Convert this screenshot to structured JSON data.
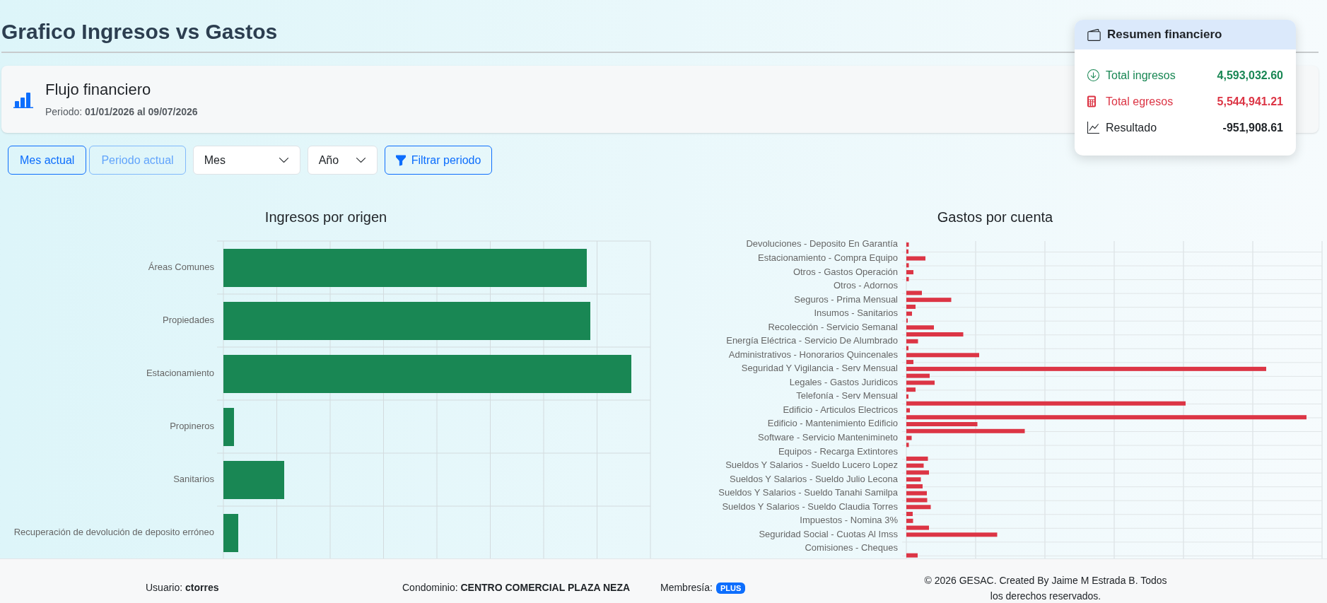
{
  "page": {
    "title": "Grafico Ingresos vs Gastos"
  },
  "flow_card": {
    "title": "Flujo financiero",
    "period": "Periodo: **01/01/2026 al 09/07/2026**"
  },
  "filters": [
    {
      "kind": "button",
      "label": "Mes actual",
      "disabled": false
    },
    {
      "kind": "button",
      "label": "Periodo actual",
      "disabled": true
    },
    {
      "kind": "select",
      "value": "Mes",
      "disabled": false
    },
    {
      "kind": "select",
      "value": "Año",
      "disabled": false
    },
    {
      "kind": "filter_button",
      "label": "Filtrar periodo",
      "disabled": false
    }
  ],
  "summary": {
    "title": "Resumen financiero",
    "rows": [
      {
        "kind": "income",
        "label": "Total ingresos",
        "value": "4,593,032.60"
      },
      {
        "kind": "expense",
        "label": "Total egresos",
        "value": "5,544,941.21"
      },
      {
        "kind": "result",
        "label": "Resultado",
        "value": "-951,908.61"
      }
    ]
  },
  "income_chart": {
    "title": "Ingresos por origen",
    "labels": [
      "Áreas Comunes",
      "Propiedades",
      "Estacionamiento",
      "Propineros",
      "Sanitarios",
      "Recuperación de devolución de deposito erróneo"
    ]
  },
  "expense_chart": {
    "title": "Gastos por cuenta",
    "labels": [
      "Devoluciones - Deposito En Garantía",
      "Estacionamiento - Compra Equipo",
      "Otros - Gastos Operación",
      "Otros - Adornos",
      "Seguros - Prima Mensual",
      "Insumos - Sanitarios",
      "Recolección - Servicio Semanal",
      "Energía Eléctrica - Servicio De Alumbrado",
      "Administrativos - Honorarios Quincenales",
      "Seguridad Y Vigilancia - Serv Mensual",
      "Legales - Gastos Juridicos",
      "Telefonía - Serv Mensual",
      "Edificio - Articulos Electricos",
      "Edificio - Mantenimiento Edificio",
      "Software - Servicio Mantenimineto",
      "Equipos - Recarga Extintores",
      "Sueldos Y Salarios - Sueldo Lucero Lopez",
      "Sueldos Y Salarios - Sueldo Julio Lecona",
      "Sueldos Y Salarios - Sueldo Tanahi Samilpa",
      "Sueldos Y Salarios - Sueldo Claudia Torres",
      "Impuestos - Nomina 3%",
      "Seguridad Social - Cuotas Al Imss",
      "Comisiones - Cheques"
    ]
  },
  "footer": {
    "user": "Usuario: **ctorres**",
    "condo": "Condominio: **CENTRO COMERCIAL PLAZA NEZA**",
    "membership_label": "Membresía:",
    "membership_badge": "PLUS",
    "copyright": "© 2026 GESAC. Created By Jaime M Estrada B. Todos los derechos reservados."
  }
}
